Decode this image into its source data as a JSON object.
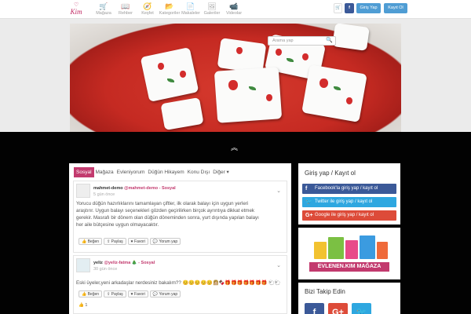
{
  "logo": {
    "text": "Kim"
  },
  "nav": [
    {
      "label": "Mağaza",
      "icon": "shopping-cart-icon",
      "glyph": "🛒"
    },
    {
      "label": "Rehber",
      "icon": "book-icon",
      "glyph": "📖"
    },
    {
      "label": "Keşfet",
      "icon": "compass-icon",
      "glyph": "🧭"
    },
    {
      "label": "Kategoriler",
      "icon": "folder-icon",
      "glyph": "📂"
    },
    {
      "label": "Makaleler",
      "icon": "document-icon",
      "glyph": "📄"
    },
    {
      "label": "Galeriler",
      "icon": "image-icon",
      "glyph": "🖼"
    },
    {
      "label": "Videolar",
      "icon": "video-icon",
      "glyph": "📹"
    }
  ],
  "header": {
    "cart_glyph": "🛒",
    "facebook_glyph": "f",
    "login_label": "Giriş Yap",
    "register_label": "Kayıt Ol"
  },
  "search": {
    "placeholder": "Arama yap",
    "glyph": "🔍"
  },
  "slider": {
    "dots_count": 8,
    "active_dot": 0
  },
  "scroll_glyph": "︽",
  "tabs": [
    "Sosyal",
    "Mağaza",
    "Evleniyorum",
    "Düğün Hikayem",
    "Konu Dışı",
    "Diğer ▾"
  ],
  "posts": [
    {
      "user": "mahmet-demo",
      "handle": "@mahmet-demo",
      "channel": "- Sosyal",
      "date": "5 gün önce",
      "text_lines": [
        "Yorucu düğün hazırlıklarını tamamlayan çiftler, ilk olarak balayı için uygun yerleri",
        "araştırır. Uygun balayı seçenekleri gözden geçirilirken birçok ayrıntıya dikkat etmek",
        "gerekir. Masrafı bir dönem olan düğün döneminden sonra, yurt dışında yapılan balayı",
        "her aile bütçesine uygun olmayacaktır."
      ],
      "buttons": [
        "👍 Beğen",
        "⇪ Paylaş",
        "♥ Favori",
        "💬 Yorum yap"
      ]
    },
    {
      "user": "yeliz",
      "handle": "@yeliz-fatma",
      "channel": "🎄 - Sosyal",
      "date": "30 gün önce",
      "text_lines": [
        "Eski üyeler,yeni arkadaşlar nerdesiniz bakalım?? 😊😊😊😊😊👩🏼🍫🎁🎁🎁🎁🎁🎁🎁 🐑🐑"
      ],
      "buttons": [
        "👍 Beğen",
        "⇪ Paylaş",
        "♥ Favori",
        "💬 Yorum yap"
      ],
      "like_count": "1"
    }
  ],
  "sidebar": {
    "login_title": "Giriş yap / Kayıt ol",
    "facebook_label": "Facebook'la giriş yap / kayıt ol",
    "twitter_label": "Twitter ile giriş yap / kayıt ol",
    "google_label": "Google ile giriş yap / kayıt ol",
    "banner_text": "EVLENEN.KIM MAĞAZA",
    "follow_title": "Bizi Takip Edin",
    "follow": [
      {
        "glyph": "f",
        "icon": "facebook-icon",
        "color": "#3b5998"
      },
      {
        "glyph": "G+",
        "icon": "google-plus-icon",
        "color": "#dd4b39"
      },
      {
        "glyph": "🐦",
        "icon": "twitter-icon",
        "color": "#2ea7e0"
      }
    ]
  },
  "colors": {
    "brand": "#c23a6e",
    "facebook": "#3b5998",
    "twitter": "#2ea7e0",
    "google": "#dd4b39",
    "header_button": "#4f9dd4"
  }
}
